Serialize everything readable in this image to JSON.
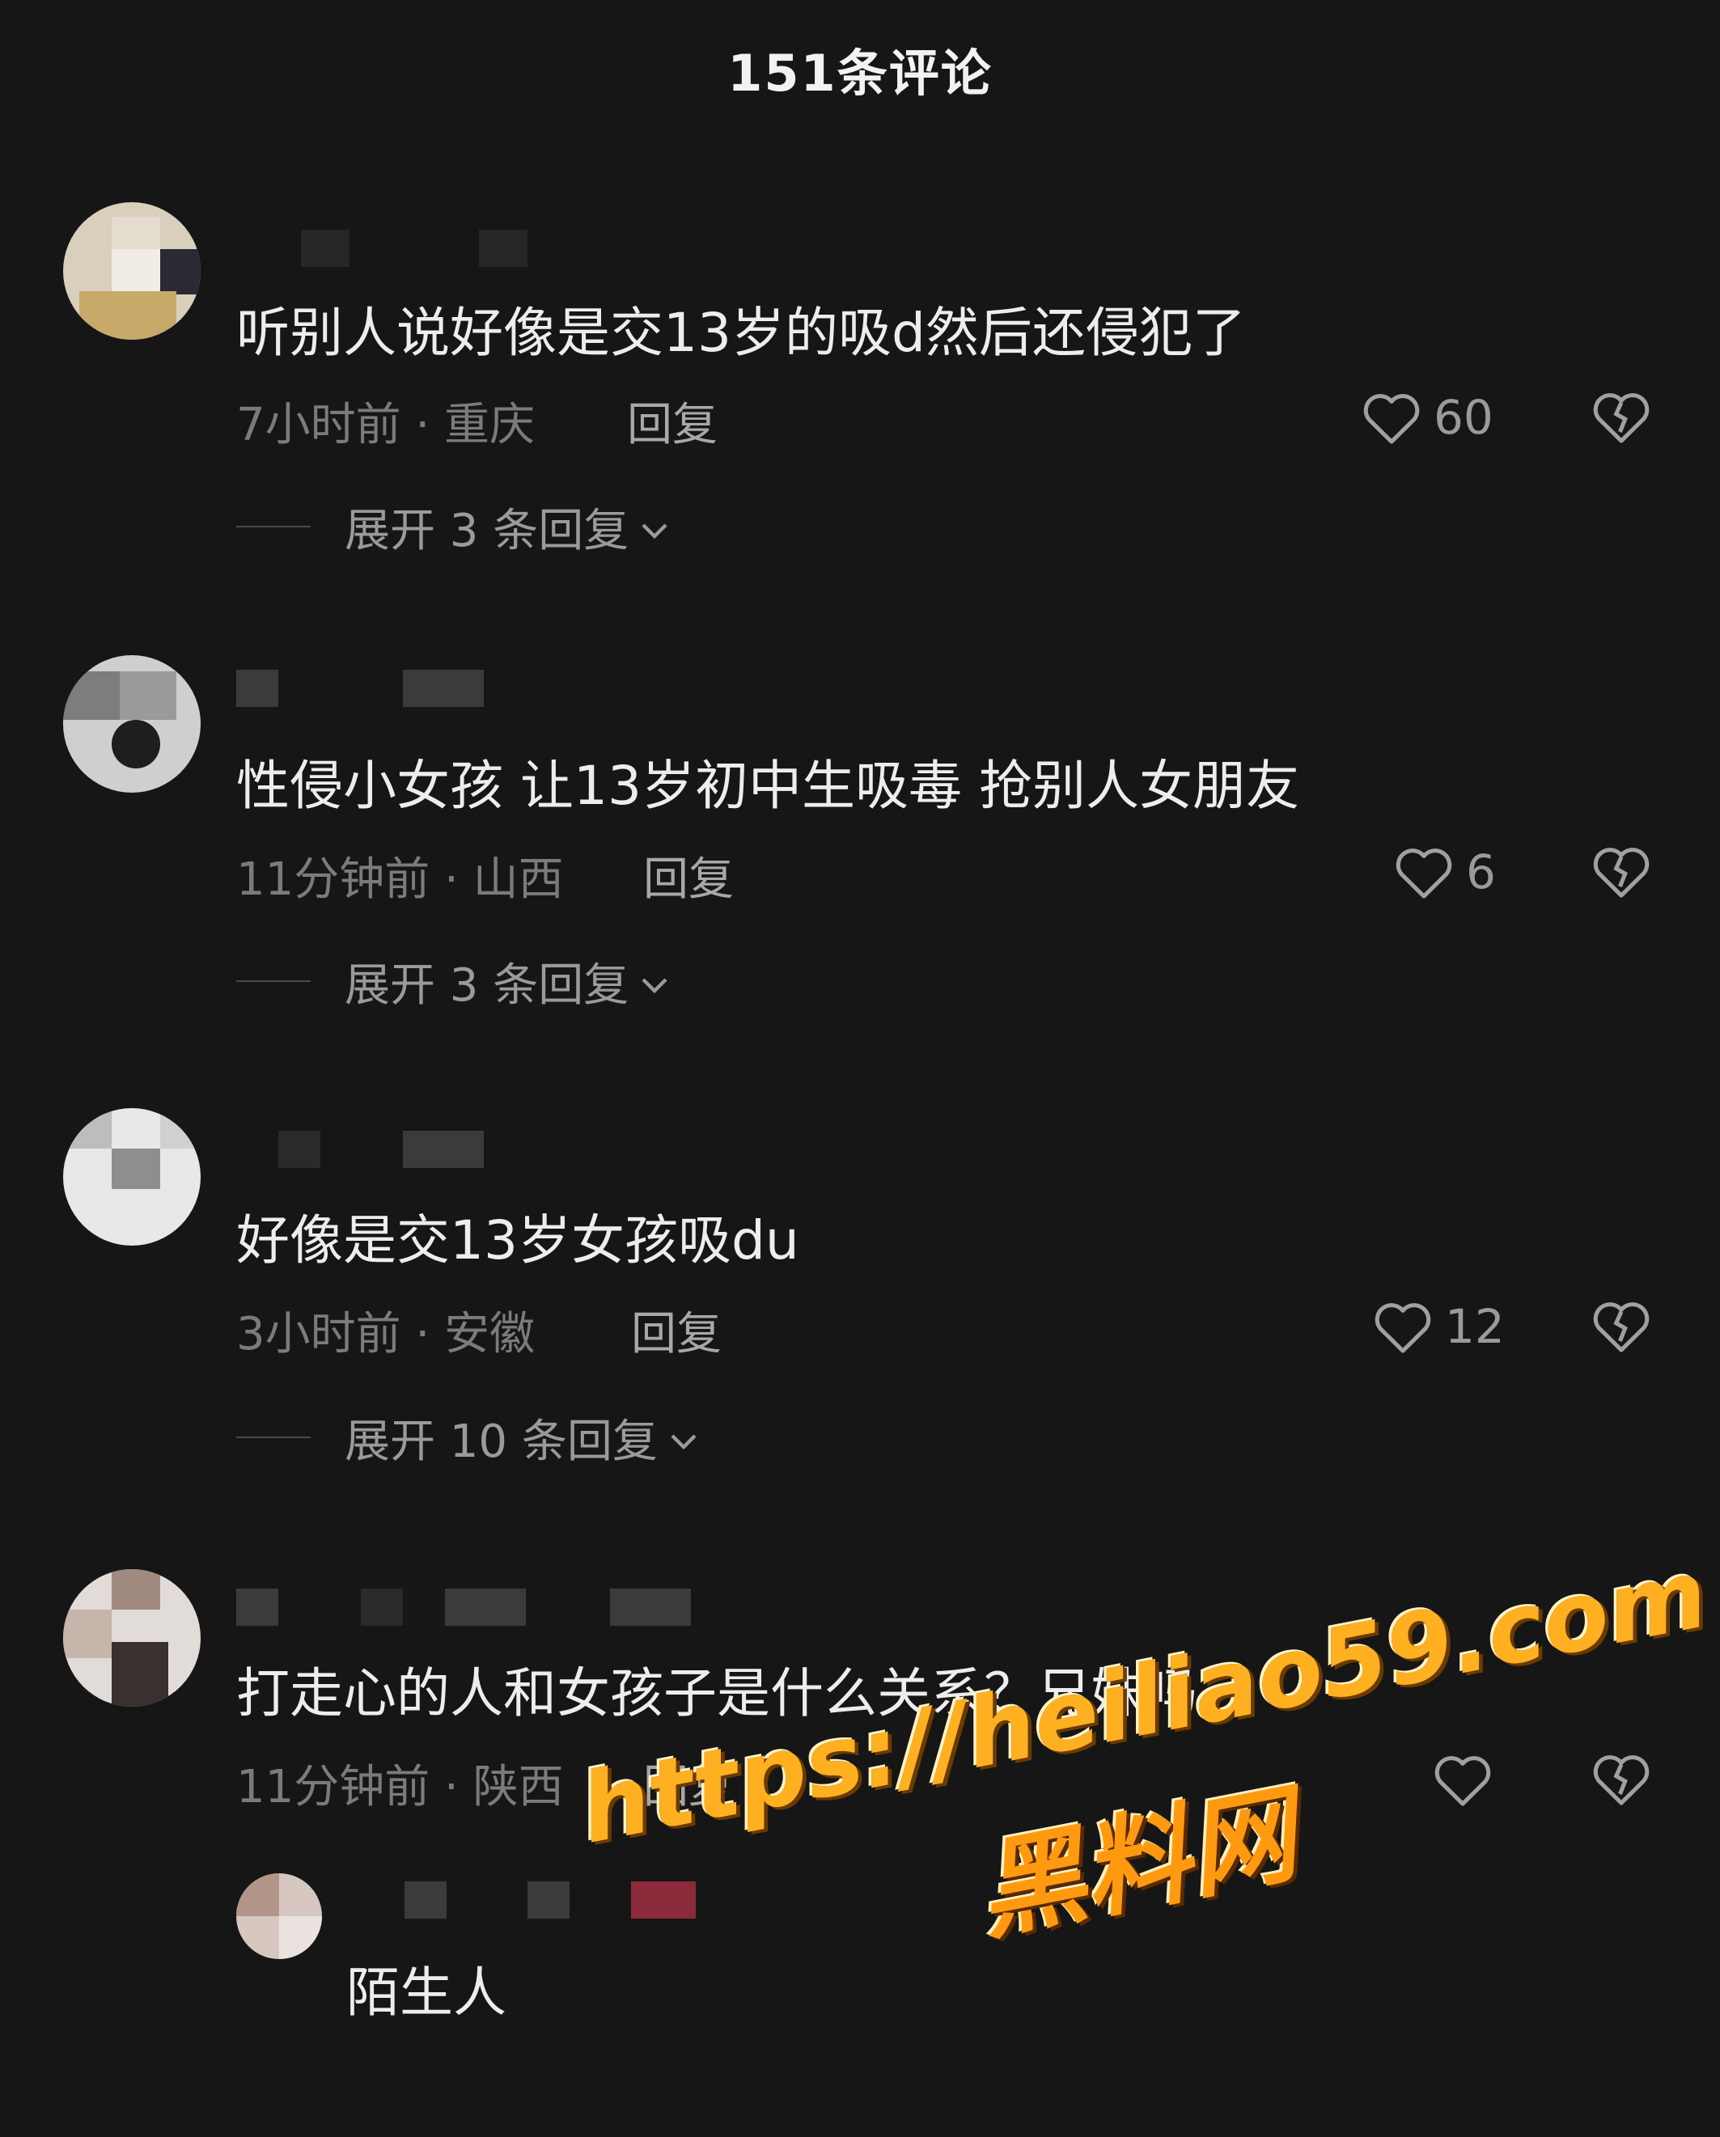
{
  "header": {
    "title": "151条评论"
  },
  "comments": [
    {
      "text": "听别人说好像是交13岁的吸d然后还侵犯了",
      "time_location": "7小时前 · 重庆",
      "reply_label": "回复",
      "likes": "60",
      "expand_label": "展开 3 条回复"
    },
    {
      "text": "性侵小女孩 让13岁初中生吸毒 抢别人女朋友",
      "time_location": "11分钟前 · 山西",
      "reply_label": "回复",
      "likes": "6",
      "expand_label": "展开 3 条回复"
    },
    {
      "text": "好像是交13岁女孩吸du",
      "time_location": "3小时前 · 安徽",
      "reply_label": "回复",
      "likes": "12",
      "expand_label": "展开 10 条回复"
    },
    {
      "text": "打走心的人和女孩子是什么关系？兄妹吗",
      "time_location": "11分钟前 · 陕西",
      "reply_label": "回复"
    }
  ],
  "sub_reply": {
    "text": "陌生人"
  },
  "watermark": {
    "url": "https://heiliao59.com",
    "name": "黑料网"
  },
  "icons": [
    "heart-icon",
    "broken-heart-icon",
    "chevron-down-icon"
  ],
  "colors": {
    "background": "#161616",
    "text": "#ededed",
    "muted": "#7b7b7b",
    "watermark": "#ffb020"
  }
}
